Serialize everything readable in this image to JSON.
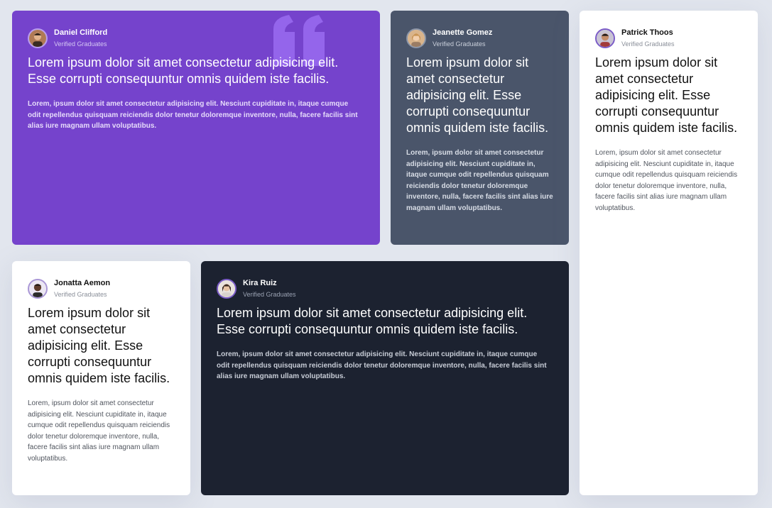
{
  "testimonials": [
    {
      "name": "Daniel Clifford",
      "role": "Verified Graduates",
      "quote": "Lorem ipsum dolor sit amet consectetur adipisicing elit. Esse corrupti consequuntur omnis quidem iste facilis.",
      "body": "Lorem, ipsum dolor sit amet consectetur adipisicing elit. Nesciunt cupiditate in, itaque cumque odit repellendus quisquam reiciendis dolor tenetur doloremque inventore, nulla, facere facilis sint alias iure magnam ullam voluptatibus."
    },
    {
      "name": "Jeanette Gomez",
      "role": "Verified Graduates",
      "quote": "Lorem ipsum dolor sit amet consectetur adipisicing elit. Esse corrupti consequuntur omnis quidem iste facilis.",
      "body": "Lorem, ipsum dolor sit amet consectetur adipisicing elit. Nesciunt cupiditate in, itaque cumque odit repellendus quisquam reiciendis dolor tenetur doloremque inventore, nulla, facere facilis sint alias iure magnam ullam voluptatibus."
    },
    {
      "name": "Patrick Thoos",
      "role": "Verified Graduates",
      "quote": "Lorem ipsum dolor sit amet consectetur adipisicing elit. Esse corrupti consequuntur omnis quidem iste facilis.",
      "body": "Lorem, ipsum dolor sit amet consectetur adipisicing elit. Nesciunt cupiditate in, itaque cumque odit repellendus quisquam reiciendis dolor tenetur doloremque inventore, nulla, facere facilis sint alias iure magnam ullam voluptatibus."
    },
    {
      "name": "Jonatta Aemon",
      "role": "Verified Graduates",
      "quote": "Lorem ipsum dolor sit amet consectetur adipisicing elit. Esse corrupti consequuntur omnis quidem iste facilis.",
      "body": "Lorem, ipsum dolor sit amet consectetur adipisicing elit. Nesciunt cupiditate in, itaque cumque odit repellendus quisquam reiciendis dolor tenetur doloremque inventore, nulla, facere facilis sint alias iure magnam ullam voluptatibus."
    },
    {
      "name": "Kira Ruiz",
      "role": "Verified Graduates",
      "quote": "Lorem ipsum dolor sit amet consectetur adipisicing elit. Esse corrupti consequuntur omnis quidem iste facilis.",
      "body": "Lorem, ipsum dolor sit amet consectetur adipisicing elit. Nesciunt cupiditate in, itaque cumque odit repellendus quisquam reiciendis dolor tenetur doloremque inventore, nulla, facere facilis sint alias iure magnam ullam voluptatibus."
    }
  ],
  "colors": {
    "purple_card": "#7543cc",
    "slate_card": "#4a556a",
    "white_card": "#ffffff",
    "dark_card": "#1c2230",
    "page_background": "#e2e6ee"
  },
  "icons": {
    "decorative_quote": "quote-icon"
  }
}
